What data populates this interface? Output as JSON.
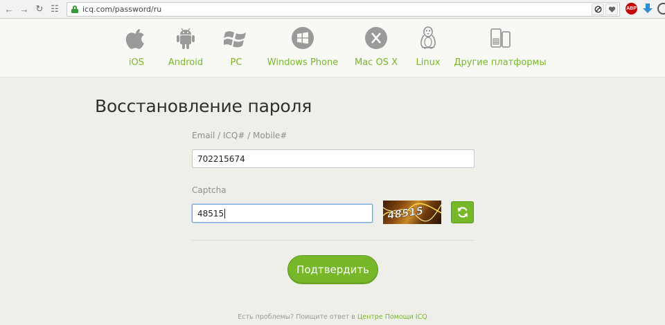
{
  "browser": {
    "url": "icq.com/password/ru",
    "nav": {
      "back_icon": "←",
      "forward_icon": "→",
      "reload_icon": "↻",
      "apps_icon": "☷"
    },
    "ext_abp_label": "ABP"
  },
  "platforms": [
    {
      "label": "iOS",
      "icon": "apple-icon"
    },
    {
      "label": "Android",
      "icon": "android-icon"
    },
    {
      "label": "PC",
      "icon": "windows-flag-icon"
    },
    {
      "label": "Windows Phone",
      "icon": "windows-phone-icon"
    },
    {
      "label": "Mac OS X",
      "icon": "mac-os-x-icon"
    },
    {
      "label": "Linux",
      "icon": "linux-tux-icon"
    },
    {
      "label": "Другие платформы",
      "icon": "devices-icon"
    }
  ],
  "page": {
    "title": "Восстановление пароля",
    "email_label": "Email / ICQ# / Mobile#",
    "email_value": "702215674",
    "captcha_label": "Captcha",
    "captcha_value": "48515",
    "captcha_image_text": "48515",
    "submit_label": "Подтвердить",
    "footer_text": "Есть проблемы? Поищите ответ в ",
    "footer_link": "Центре Помощи ICQ"
  },
  "colors": {
    "accent": "#76b82a",
    "page_bg": "#efefe9",
    "title": "#2f2f2f"
  }
}
